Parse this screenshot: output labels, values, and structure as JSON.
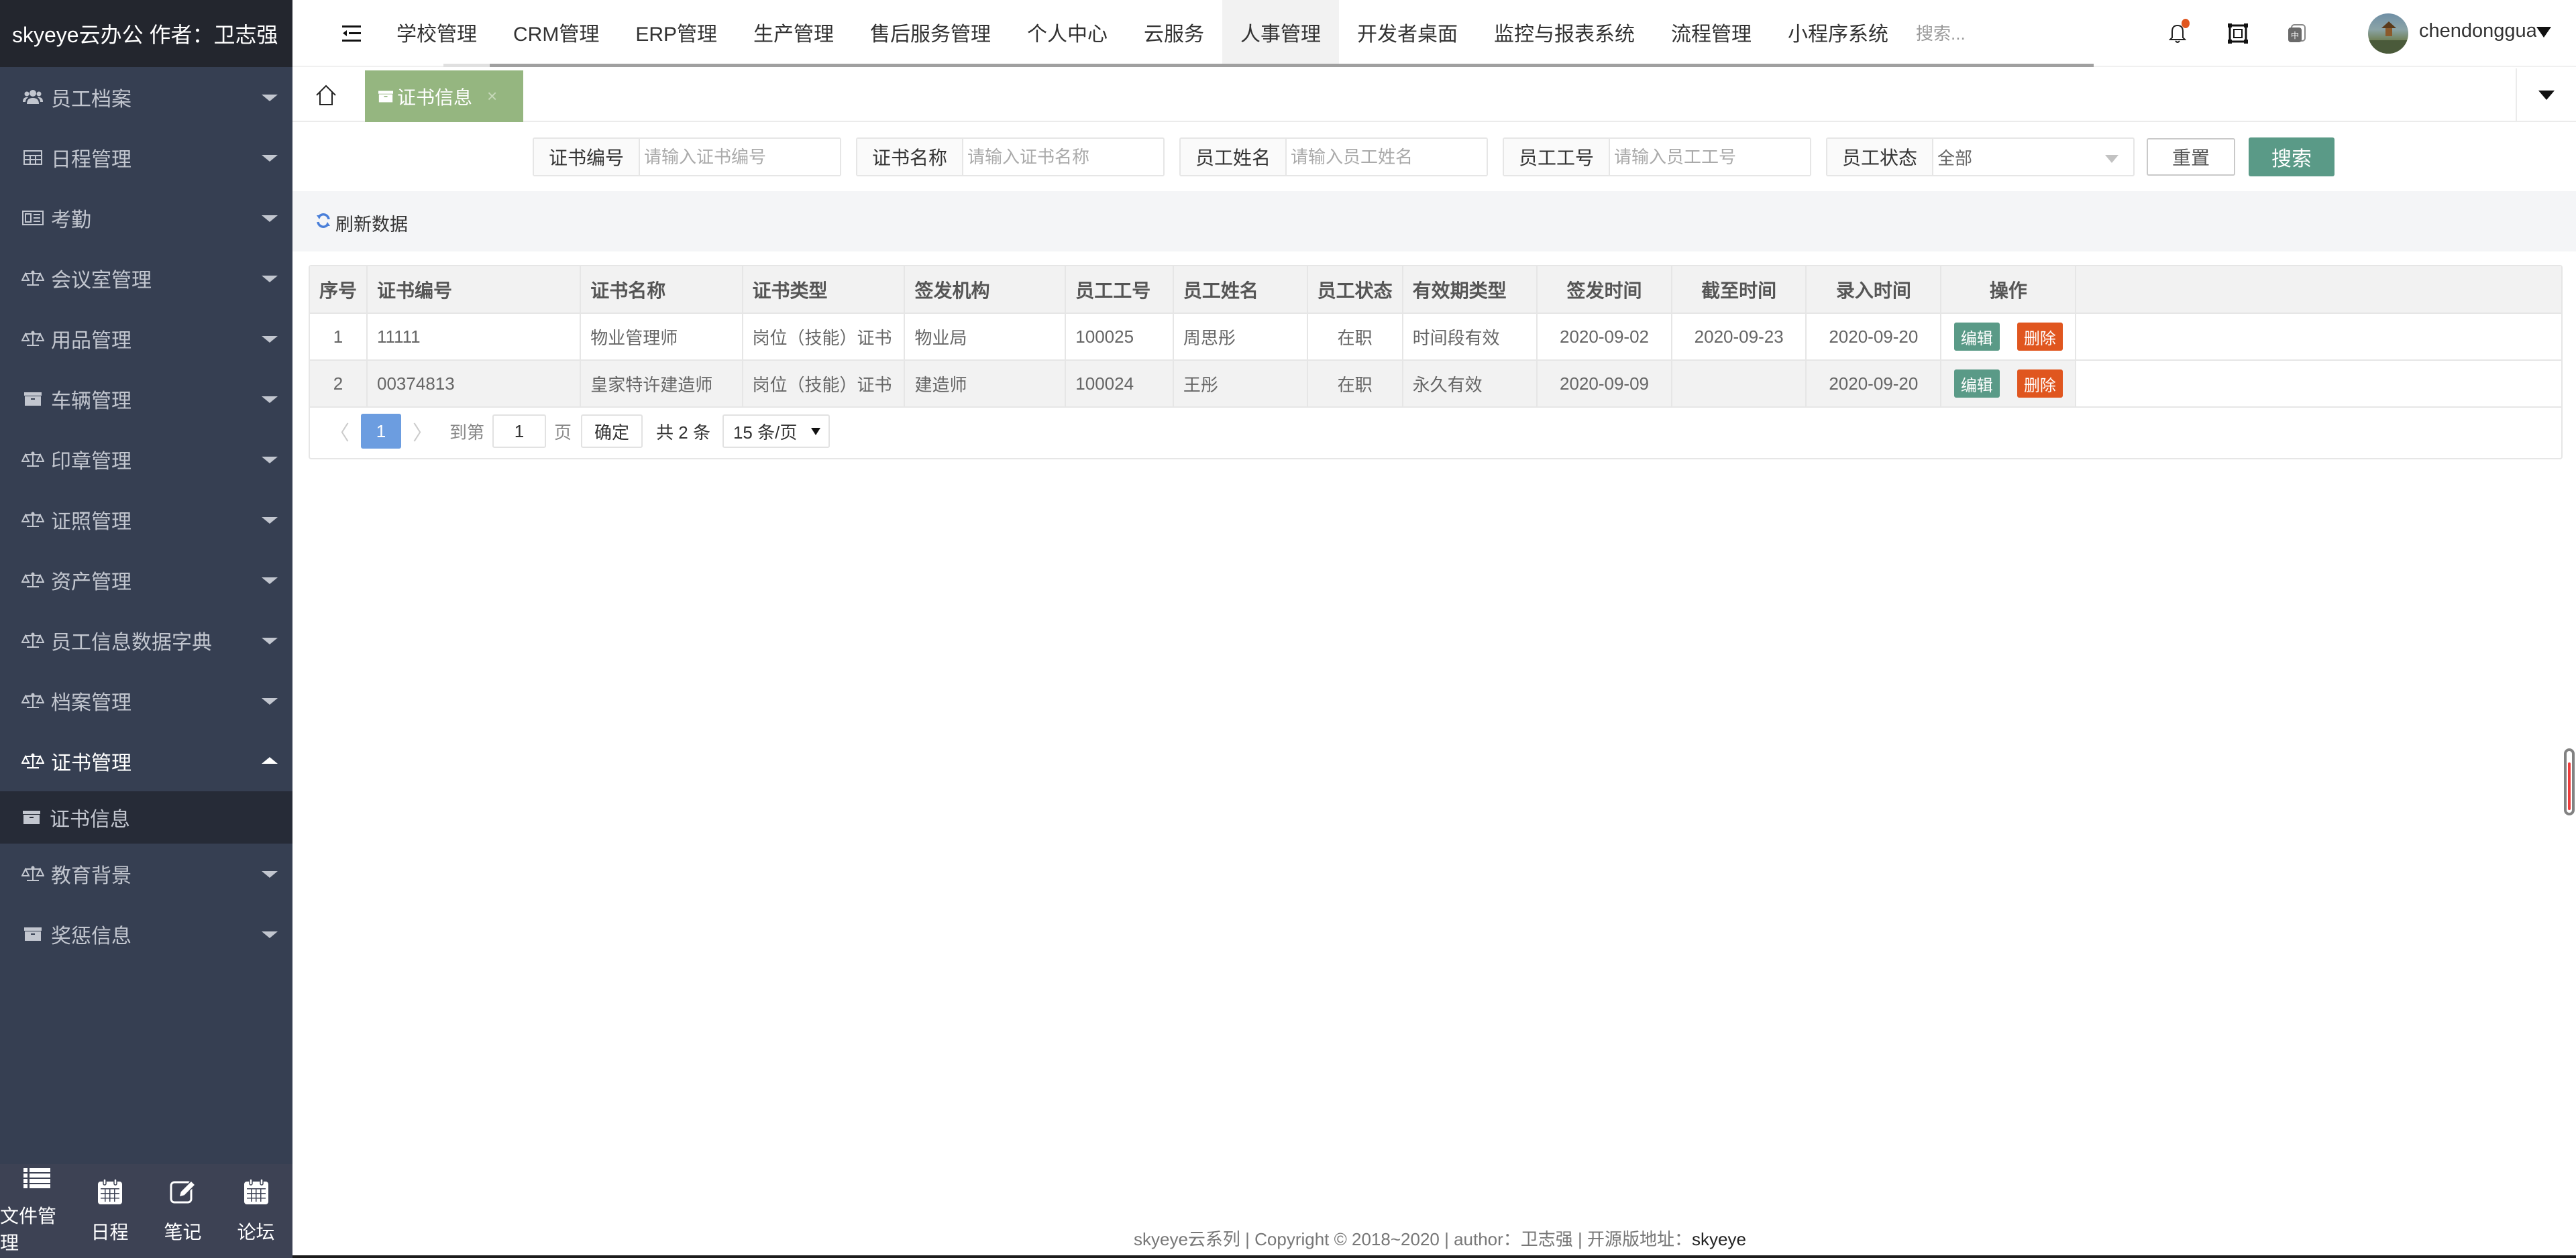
{
  "brand": {
    "title": "skyeye云办公 作者：卫志强"
  },
  "topnav": {
    "tabs": [
      {
        "label": "学校管理"
      },
      {
        "label": "CRM管理"
      },
      {
        "label": "ERP管理"
      },
      {
        "label": "生产管理"
      },
      {
        "label": "售后服务管理"
      },
      {
        "label": "个人中心"
      },
      {
        "label": "云服务"
      },
      {
        "label": "人事管理",
        "active": true
      },
      {
        "label": "开发者桌面"
      },
      {
        "label": "监控与报表系统"
      },
      {
        "label": "流程管理"
      },
      {
        "label": "小程序系统"
      }
    ],
    "search_placeholder": "搜索...",
    "icons": {
      "notifications": "bell-icon",
      "fullscreen": "fullscreen-icon",
      "language": "language-icon"
    },
    "language_badge": "中",
    "username": "chendongguan",
    "notification_dot_color": "#e0561f"
  },
  "sidebar": {
    "items": [
      {
        "label": "员工档案",
        "icon": "users-icon"
      },
      {
        "label": "日程管理",
        "icon": "table-icon"
      },
      {
        "label": "考勤",
        "icon": "id-card-icon"
      },
      {
        "label": "会议室管理",
        "icon": "balance-scale-icon"
      },
      {
        "label": "用品管理",
        "icon": "balance-scale-icon"
      },
      {
        "label": "车辆管理",
        "icon": "archive-icon"
      },
      {
        "label": "印章管理",
        "icon": "balance-scale-icon"
      },
      {
        "label": "证照管理",
        "icon": "balance-scale-icon"
      },
      {
        "label": "资产管理",
        "icon": "balance-scale-icon"
      },
      {
        "label": "员工信息数据字典",
        "icon": "balance-scale-icon"
      },
      {
        "label": "档案管理",
        "icon": "balance-scale-icon"
      },
      {
        "label": "证书管理",
        "icon": "balance-scale-icon",
        "open": true,
        "children": [
          {
            "label": "证书信息",
            "icon": "archive-icon",
            "active": true
          }
        ]
      },
      {
        "label": "教育背景",
        "icon": "balance-scale-icon"
      },
      {
        "label": "奖惩信息",
        "icon": "archive-icon"
      }
    ],
    "bottom": [
      {
        "label": "文件管理",
        "icon": "list-icon"
      },
      {
        "label": "日程",
        "icon": "calendar-icon"
      },
      {
        "label": "笔记",
        "icon": "edit-icon"
      },
      {
        "label": "论坛",
        "icon": "calendar-icon"
      }
    ]
  },
  "tabbar": {
    "home_icon": "home-icon",
    "active_tab": {
      "label": "证书信息",
      "icon": "archive-icon",
      "close": "×"
    },
    "accent": "#95b680"
  },
  "filters": {
    "fields": [
      {
        "label": "证书编号",
        "placeholder": "请输入证书编号",
        "value": ""
      },
      {
        "label": "证书名称",
        "placeholder": "请输入证书名称",
        "value": ""
      },
      {
        "label": "员工姓名",
        "placeholder": "请输入员工姓名",
        "value": ""
      },
      {
        "label": "员工工号",
        "placeholder": "请输入员工工号",
        "value": ""
      }
    ],
    "status": {
      "label": "员工状态",
      "selected": "全部"
    },
    "reset_label": "重置",
    "search_label": "搜索"
  },
  "toolbar": {
    "refresh_label": "刷新数据"
  },
  "table": {
    "columns": [
      "序号",
      "证书编号",
      "证书名称",
      "证书类型",
      "签发机构",
      "员工工号",
      "员工姓名",
      "员工状态",
      "有效期类型",
      "签发时间",
      "截至时间",
      "录入时间",
      "操作"
    ],
    "rows": [
      {
        "index": "1",
        "cert_no": "11111",
        "cert_name": "物业管理师",
        "cert_type": "岗位（技能）证书",
        "issuer": "物业局",
        "emp_no": "100025",
        "emp_name": "周思彤",
        "emp_status": "在职",
        "validity": "时间段有效",
        "issue_date": "2020-09-02",
        "expire_date": "2020-09-23",
        "entry_date": "2020-09-20"
      },
      {
        "index": "2",
        "cert_no": "00374813",
        "cert_name": "皇家特许建造师",
        "cert_type": "岗位（技能）证书",
        "issuer": "建造师",
        "emp_no": "100024",
        "emp_name": "王彤",
        "emp_status": "在职",
        "validity": "永久有效",
        "issue_date": "2020-09-09",
        "expire_date": "",
        "entry_date": "2020-09-20"
      }
    ],
    "actions": {
      "edit": "编辑",
      "delete": "删除"
    }
  },
  "pagination": {
    "prev": "〈",
    "next": "〉",
    "current_page": "1",
    "goto_label": "到第",
    "goto_value": "1",
    "page_suffix": "页",
    "confirm_label": "确定",
    "total_label": "共 2 条",
    "page_size": "15 条/页"
  },
  "footer": {
    "text": "skyeye云系列 | Copyright © 2018~2020 | author：卫志强 | 开源版地址：",
    "link": "skyeye"
  },
  "side_indicator": {
    "level": 0.85,
    "color": "#f03a3a"
  }
}
